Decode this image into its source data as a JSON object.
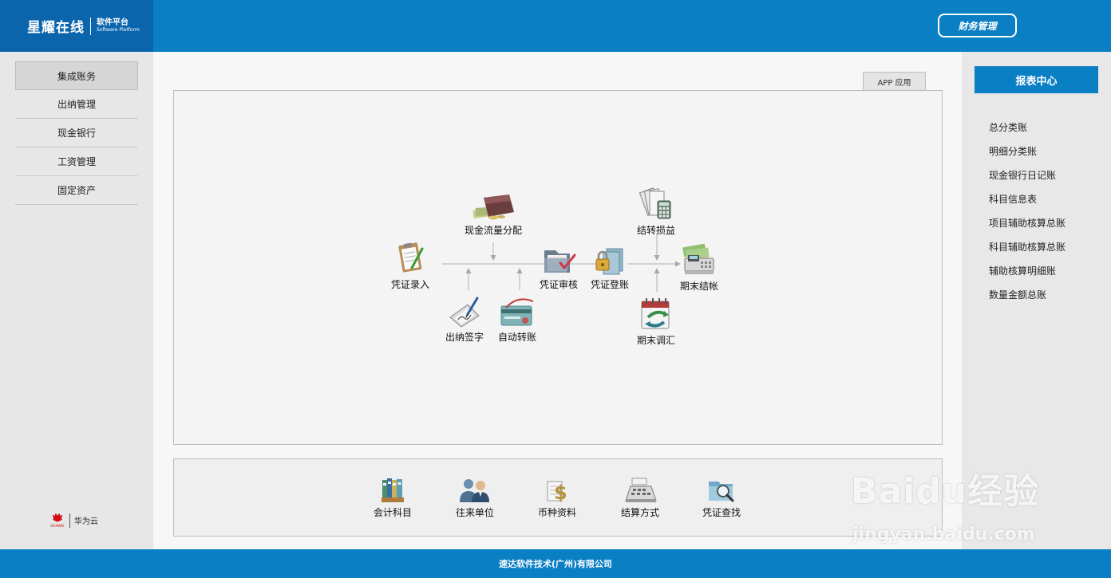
{
  "header": {
    "logo_main": "星耀在线",
    "logo_sub_zh": "软件平台",
    "logo_sub_en": "Software Platform",
    "finance_button": "财务管理"
  },
  "sidebar": {
    "items": [
      {
        "label": "集成账务",
        "active": true
      },
      {
        "label": "出纳管理",
        "active": false
      },
      {
        "label": "现金银行",
        "active": false
      },
      {
        "label": "工资管理",
        "active": false
      },
      {
        "label": "固定资产",
        "active": false
      }
    ],
    "partner_logo_text": "HUAWEI",
    "partner_name": "华为云"
  },
  "main": {
    "app_tab": "APP 应用",
    "flow": {
      "voucher_entry": "凭证录入",
      "cash_flow": "现金流量分配",
      "cashier_sign": "出纳签字",
      "auto_transfer": "自动转账",
      "voucher_audit": "凭证审核",
      "voucher_post": "凭证登账",
      "transfer_pl": "结转损益",
      "period_adjust": "期末调汇",
      "period_close": "期末结帐"
    },
    "tools": [
      {
        "label": "会计科目",
        "icon": "binders-icon"
      },
      {
        "label": "往来单位",
        "icon": "people-icon"
      },
      {
        "label": "币种资料",
        "icon": "dollar-icon"
      },
      {
        "label": "结算方式",
        "icon": "cash-register-icon"
      },
      {
        "label": "凭证查找",
        "icon": "folder-search-icon"
      }
    ]
  },
  "report": {
    "title": "报表中心",
    "links": [
      "总分类账",
      "明细分类账",
      "现金银行日记账",
      "科目信息表",
      "项目辅助核算总账",
      "科目辅助核算总账",
      "辅助核算明细账",
      "数量金额总账"
    ]
  },
  "footer": {
    "text": "速达软件技术(广州)有限公司"
  },
  "watermark": {
    "main": "Baidu经验",
    "sub": "jingyan.baidu.com"
  },
  "colors": {
    "primary": "#0a7fc4",
    "logo_bg": "#0b65ad",
    "sidebar_bg": "#e7e7e7"
  }
}
